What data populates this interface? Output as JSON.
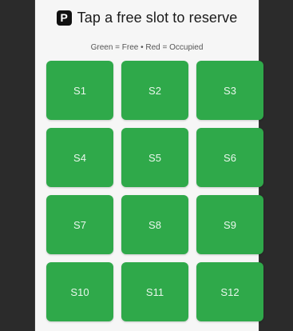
{
  "header": {
    "icon": "parking-icon",
    "icon_glyph": "P",
    "title": "Tap a free slot to reserve"
  },
  "legend": "Green = Free • Red = Occupied",
  "colors": {
    "free": "#2fa94a",
    "occupied": "#d93a3a",
    "background": "#f6f6f6"
  },
  "slots": [
    {
      "label": "S1",
      "status": "free"
    },
    {
      "label": "S2",
      "status": "free"
    },
    {
      "label": "S3",
      "status": "free"
    },
    {
      "label": "S4",
      "status": "free"
    },
    {
      "label": "S5",
      "status": "free"
    },
    {
      "label": "S6",
      "status": "free"
    },
    {
      "label": "S7",
      "status": "free"
    },
    {
      "label": "S8",
      "status": "free"
    },
    {
      "label": "S9",
      "status": "free"
    },
    {
      "label": "S10",
      "status": "free"
    },
    {
      "label": "S11",
      "status": "free"
    },
    {
      "label": "S12",
      "status": "free"
    }
  ]
}
